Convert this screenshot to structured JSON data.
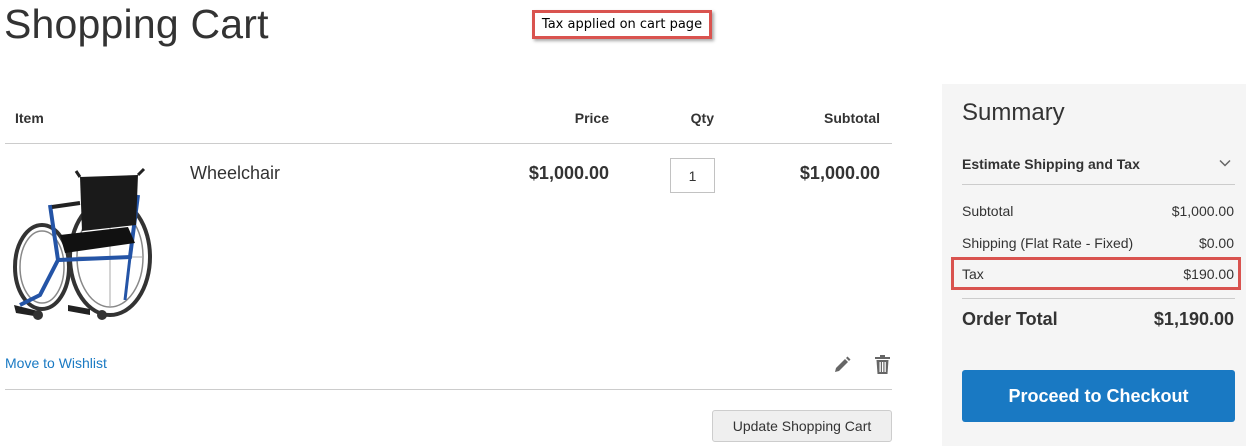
{
  "page": {
    "title": "Shopping Cart"
  },
  "annotation": {
    "text": "Tax applied on cart page",
    "color": "#d9534f"
  },
  "table": {
    "headers": {
      "item": "Item",
      "price": "Price",
      "qty": "Qty",
      "subtotal": "Subtotal"
    },
    "rows": [
      {
        "product_name": "Wheelchair",
        "price": "$1,000.00",
        "qty": "1",
        "subtotal": "$1,000.00",
        "image_icon": "wheelchair-icon",
        "wishlist_label": "Move to Wishlist",
        "edit_icon": "pencil-icon",
        "delete_icon": "trash-icon"
      }
    ],
    "update_button_label": "Update Shopping Cart"
  },
  "summary": {
    "title": "Summary",
    "estimate_label": "Estimate Shipping and Tax",
    "estimate_icon": "chevron-down-icon",
    "rows": {
      "subtotal": {
        "label": "Subtotal",
        "value": "$1,000.00"
      },
      "shipping": {
        "label": "Shipping (Flat Rate - Fixed)",
        "value": "$0.00"
      },
      "tax": {
        "label": "Tax",
        "value": "$190.00"
      }
    },
    "order_total": {
      "label": "Order Total",
      "value": "$1,190.00"
    },
    "checkout_label": "Proceed to Checkout"
  },
  "colors": {
    "accent": "#1979c3",
    "link": "#1979c3",
    "highlight": "#d9534f",
    "panel": "#f5f5f5"
  }
}
